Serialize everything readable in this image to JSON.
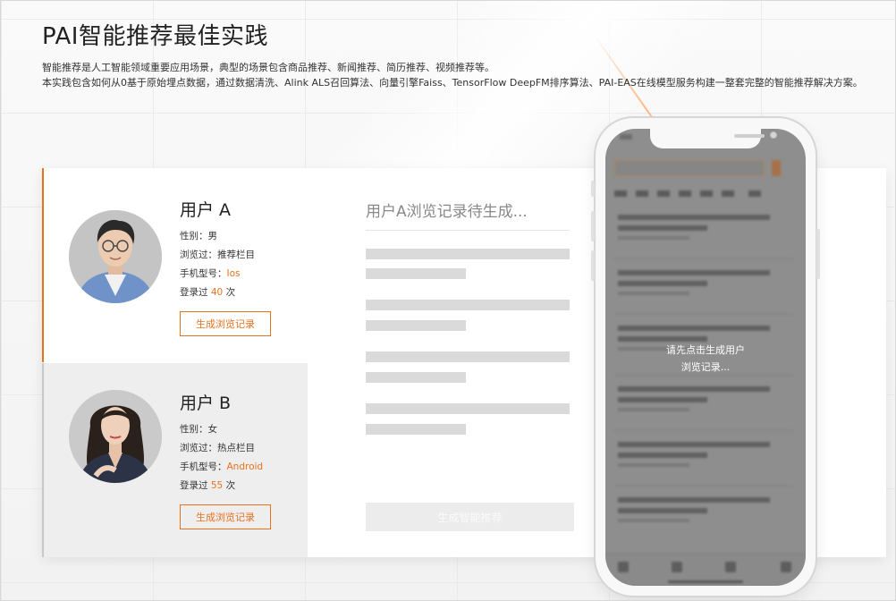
{
  "header": {
    "title": "PAI智能推荐最佳实践",
    "desc_line1": "智能推荐是人工智能领域重要应用场景，典型的场景包含商品推荐、新闻推荐、简历推荐、视频推荐等。",
    "desc_line2": "本实践包含如何从0基于原始埋点数据，通过数据清洗、Alink ALS召回算法、向量引擎Faiss、TensorFlow DeepFM排序算法、PAI-EAS在线模型服务构建一整套完整的智能推荐解决方案。"
  },
  "users": [
    {
      "name": "用户 A",
      "gender_label": "性别：",
      "gender": "男",
      "browsed_label": "浏览过：",
      "browsed": "推荐栏目",
      "phone_label": "手机型号：",
      "phone": "Ios",
      "login_prefix": "登录过",
      "login_count": "40",
      "login_suffix": "次",
      "button": "生成浏览记录"
    },
    {
      "name": "用户 B",
      "gender_label": "性别：",
      "gender": "女",
      "browsed_label": "浏览过：",
      "browsed": "热点栏目",
      "phone_label": "手机型号：",
      "phone": "Android",
      "login_prefix": "登录过",
      "login_count": "55",
      "login_suffix": "次",
      "button": "生成浏览记录"
    }
  ],
  "history": {
    "title": "用户A浏览记录待生成...",
    "recommend_button": "生成智能推荐"
  },
  "phone": {
    "message_line1": "请先点击生成用户",
    "message_line2": "浏览记录..."
  },
  "colors": {
    "accent": "#e8711d"
  }
}
